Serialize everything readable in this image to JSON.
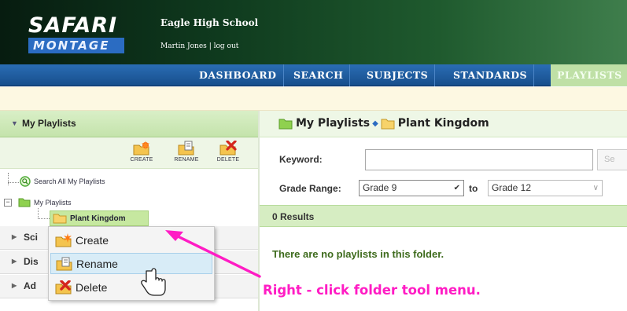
{
  "header": {
    "logo_top": "SAFARI",
    "logo_bottom": "MONTAGE",
    "school_name": "Eagle High School",
    "user_name": "Martin Jones",
    "separator": "|",
    "logout_label": "log out"
  },
  "nav": {
    "tabs": [
      {
        "label": "DASHBOARD",
        "active": false
      },
      {
        "label": "SEARCH",
        "active": false
      },
      {
        "label": "SUBJECTS",
        "active": false
      },
      {
        "label": "STANDARDS",
        "active": false
      },
      {
        "label": "PLAYLISTS",
        "active": true
      }
    ]
  },
  "sidebar": {
    "header_title": "My Playlists",
    "toolbar": {
      "create_label": "CREATE",
      "rename_label": "RENAME",
      "delete_label": "DELETE"
    },
    "tree": {
      "search_all_label": "Search All My Playlists",
      "my_playlists_label": "My Playlists",
      "selected_folder_label": "Plant Kingdom"
    },
    "collapsed_sections": [
      "Sci",
      "Dis",
      "Ad"
    ]
  },
  "context_menu": {
    "items": [
      {
        "label": "Create",
        "icon": "create-folder-icon"
      },
      {
        "label": "Rename",
        "icon": "rename-folder-icon",
        "hovered": true
      },
      {
        "label": "Delete",
        "icon": "delete-folder-icon"
      }
    ]
  },
  "main": {
    "breadcrumb": {
      "root": "My Playlists",
      "current": "Plant Kingdom"
    },
    "keyword_label": "Keyword:",
    "keyword_value": "",
    "search_button_partial": "Se",
    "grade_range_label": "Grade Range:",
    "grade_from": "Grade 9",
    "to_label": "to",
    "grade_to": "Grade 12",
    "results_count_text": "0 Results",
    "empty_message": "There are no playlists in this folder."
  },
  "annotation": {
    "text": "Right - click folder tool menu.",
    "color": "#ff1cc4"
  },
  "colors": {
    "nav_blue": "#1f5fa6",
    "active_tab_green": "#bfe0a6",
    "sidebar_header_green": "#c4e3ab",
    "results_bar_green": "#d6edc2",
    "empty_message_green": "#3e6b1d",
    "selected_folder_green": "#c6e8a0"
  }
}
